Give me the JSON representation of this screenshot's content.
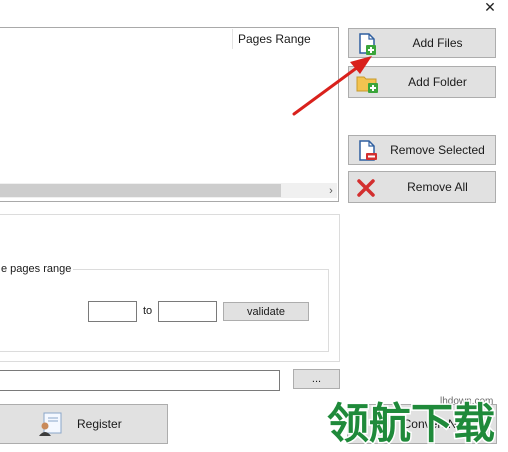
{
  "window": {
    "close_glyph": "✕"
  },
  "file_list": {
    "columns": [
      "Pages Range"
    ],
    "scroll_right_glyph": "›"
  },
  "buttons": {
    "add_files": "Add Files",
    "add_folder": "Add Folder",
    "remove_selected": "Remove Selected",
    "remove_all": "Remove All",
    "validate": "validate",
    "browse": "...",
    "register": "Register",
    "convert_now": "Convert Now"
  },
  "range": {
    "legend": "e pages range",
    "from_value": "",
    "to_label": "to",
    "to_value": ""
  },
  "output": {
    "path_value": ""
  },
  "watermark": {
    "site": "lhdown.com",
    "logo_text": "领航下载"
  },
  "icons": {
    "add_files": "file-add-icon",
    "add_folder": "folder-add-icon",
    "remove_selected": "file-remove-icon",
    "remove_all": "red-x-icon",
    "register": "certificate-user-icon",
    "convert": "convert-icon"
  },
  "colors": {
    "button_bg": "#e1e1e1",
    "green_plus": "#3aa53a",
    "red": "#d32f2f",
    "folder": "#f3c350",
    "arrow": "#d9211c",
    "watermark_green": "#1f8a3a"
  }
}
